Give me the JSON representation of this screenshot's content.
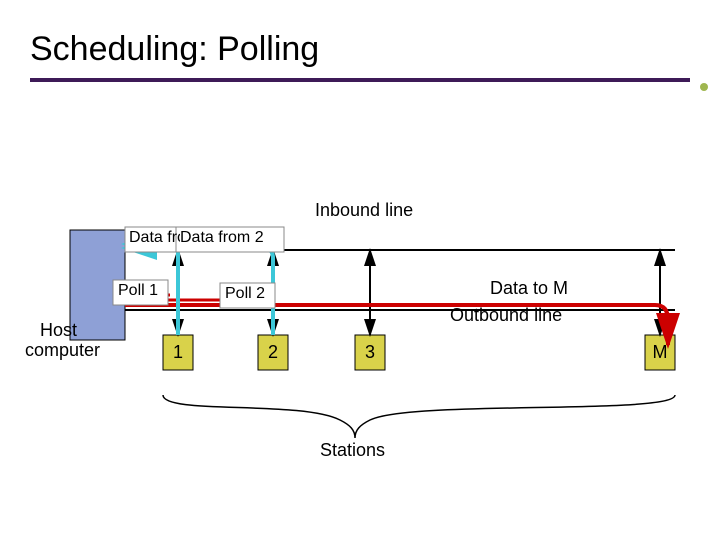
{
  "title": "Scheduling:  Polling",
  "labels": {
    "inbound": "Inbound line",
    "outbound": "Outbound line",
    "host1": "Host",
    "host2": "computer",
    "stations": "Stations",
    "dataFrom1": "Data from 1",
    "dataFrom2": "Data from 2",
    "poll1": "Poll 1",
    "poll2": "Poll 2",
    "dataToM": "Data to M"
  },
  "stations": {
    "s1": "1",
    "s2": "2",
    "s3": "3",
    "sM": "M"
  }
}
